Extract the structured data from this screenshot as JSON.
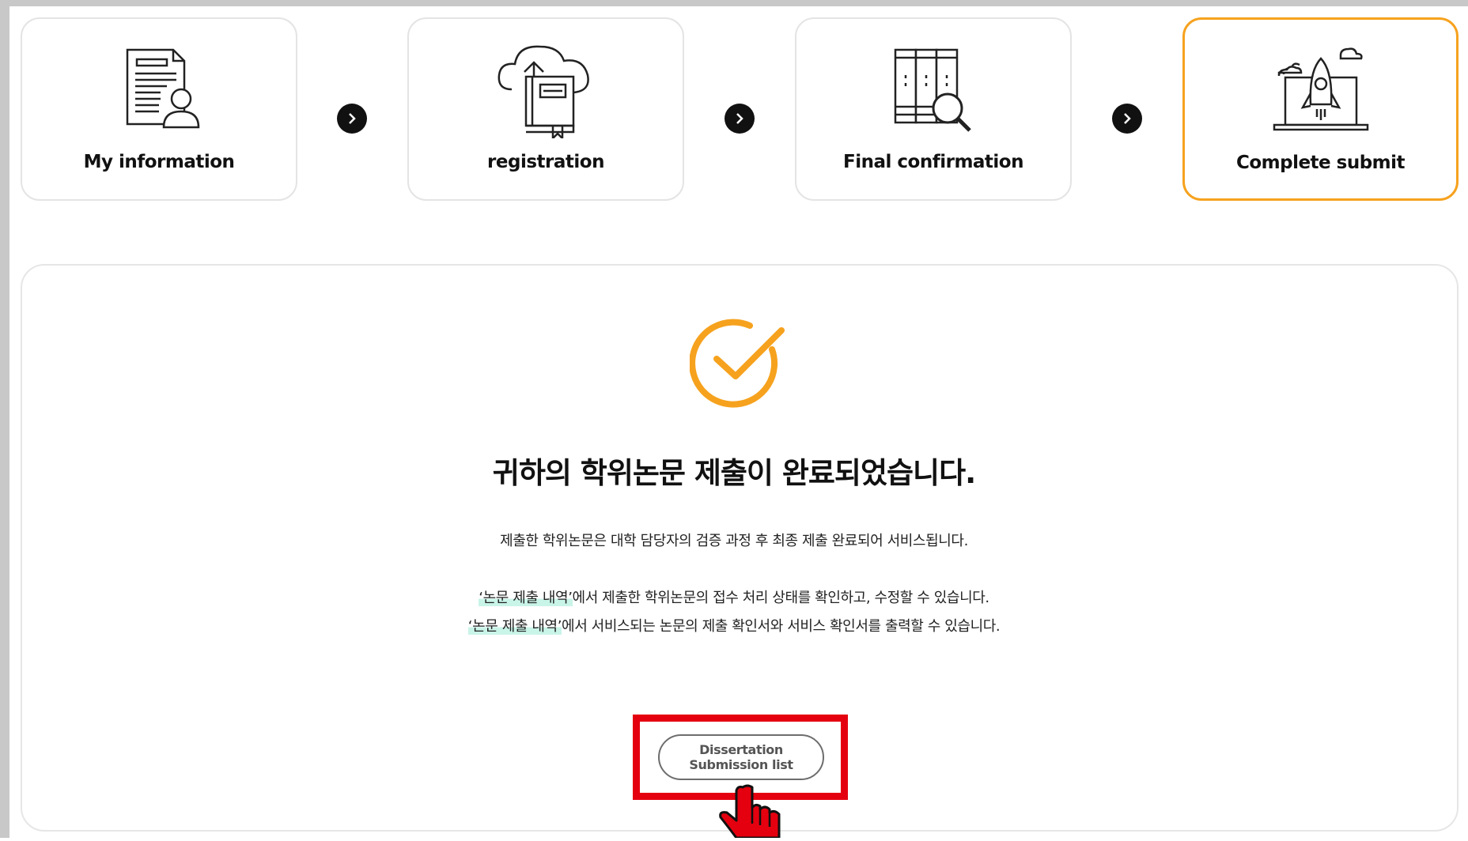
{
  "steps": [
    {
      "label": "My information",
      "icon": "document-person-icon"
    },
    {
      "label": "registration",
      "icon": "cloud-upload-book-icon"
    },
    {
      "label": "Final confirmation",
      "icon": "bookshelf-search-icon"
    },
    {
      "label": "Complete submit",
      "icon": "laptop-rocket-icon",
      "active": true
    }
  ],
  "colors": {
    "accent": "#f6a21e",
    "highlight_box": "#e4000f",
    "text_highlight": "#c9f4e8"
  },
  "result": {
    "title": "귀하의 학위논문 제출이 완료되었습니다.",
    "line1": "제출한 학위논문은 대학 담당자의 검증 과정 후 최종 제출 완료되어 서비스됩니다.",
    "line2_highlight": "‘논문 제출 내역’",
    "line2_rest": "에서 제출한 학위논문의 접수 처리 상태를 확인하고, 수정할 수 있습니다.",
    "line3_highlight": "‘논문 제출 내역’",
    "line3_rest": "에서 서비스되는 논문의 제출 확인서와 서비스 확인서를 출력할 수 있습니다.",
    "button_label": "Dissertation Submission list"
  }
}
